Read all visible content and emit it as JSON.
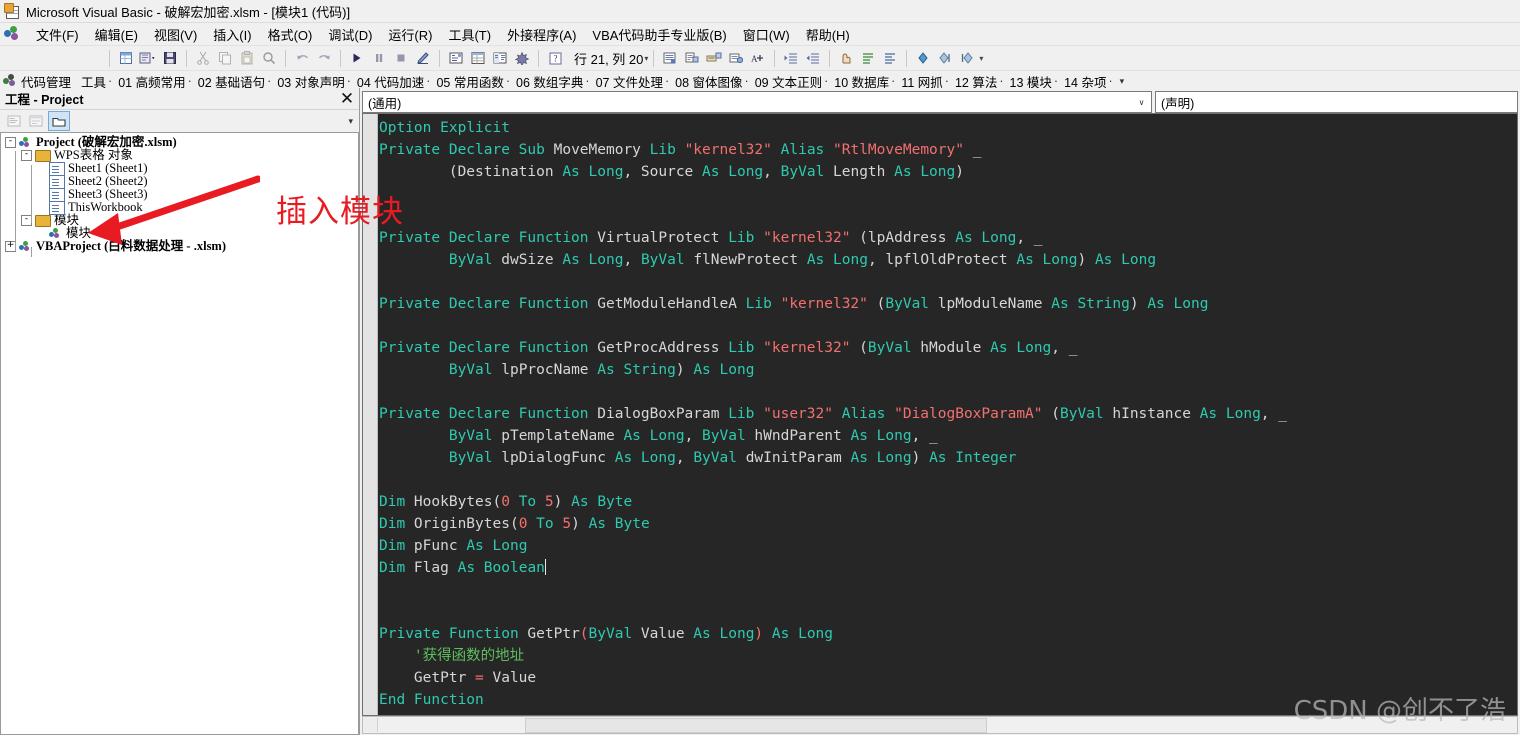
{
  "window": {
    "title": "Microsoft Visual Basic - 破解宏加密.xlsm - [模块1 (代码)]",
    "app_icon": "excel-vba-icon"
  },
  "menubar": {
    "logo_icon": "visual-basic-logo-icon",
    "items": [
      {
        "label": "文件(F)"
      },
      {
        "label": "编辑(E)"
      },
      {
        "label": "视图(V)"
      },
      {
        "label": "插入(I)"
      },
      {
        "label": "格式(O)"
      },
      {
        "label": "调试(D)"
      },
      {
        "label": "运行(R)"
      },
      {
        "label": "工具(T)"
      },
      {
        "label": "外接程序(A)"
      },
      {
        "label": "VBA代码助手专业版(B)"
      },
      {
        "label": "窗口(W)"
      },
      {
        "label": "帮助(H)"
      }
    ]
  },
  "toolbar": {
    "position_label": "行 21, 列 20",
    "group1": [
      {
        "name": "view-excel-icon",
        "glyph": "▤"
      },
      {
        "name": "insert-object-dropdown-icon",
        "glyph": "▣"
      },
      {
        "name": "save-icon",
        "glyph": "ὋE"
      }
    ],
    "group2": [
      {
        "name": "cut-icon",
        "glyph": "✂"
      },
      {
        "name": "copy-icon",
        "glyph": "❐"
      },
      {
        "name": "paste-icon",
        "glyph": "ὌB"
      },
      {
        "name": "find-icon",
        "glyph": "ὐD"
      }
    ],
    "group3": [
      {
        "name": "undo-icon",
        "glyph": "↶"
      },
      {
        "name": "redo-icon",
        "glyph": "↷"
      }
    ],
    "group4": [
      {
        "name": "run-icon",
        "glyph": "▶"
      },
      {
        "name": "pause-icon",
        "glyph": "⏸"
      },
      {
        "name": "stop-icon",
        "glyph": "■"
      },
      {
        "name": "design-mode-icon",
        "glyph": "◩"
      }
    ],
    "group5": [
      {
        "name": "project-explorer-icon",
        "glyph": "☷"
      },
      {
        "name": "properties-window-icon",
        "glyph": "☰"
      },
      {
        "name": "object-browser-icon",
        "glyph": "⧉"
      },
      {
        "name": "toolbox-icon",
        "glyph": "⚒"
      }
    ],
    "group6": [
      {
        "name": "help-icon",
        "glyph": "?"
      }
    ],
    "group7": [
      {
        "name": "list-properties-icon",
        "glyph": "▥"
      },
      {
        "name": "list-constants-icon",
        "glyph": "▦"
      },
      {
        "name": "quick-info-icon",
        "glyph": "▧"
      },
      {
        "name": "parameter-info-icon",
        "glyph": "▨"
      },
      {
        "name": "complete-word-icon",
        "glyph": "A+"
      }
    ],
    "group8": [
      {
        "name": "indent-icon",
        "glyph": "⇥"
      },
      {
        "name": "outdent-icon",
        "glyph": "⇤"
      }
    ],
    "group9": [
      {
        "name": "toggle-breakpoint-icon",
        "glyph": "✋"
      },
      {
        "name": "comment-block-icon",
        "glyph": "≡"
      },
      {
        "name": "uncomment-block-icon",
        "glyph": "≢"
      }
    ],
    "group10": [
      {
        "name": "toggle-bookmark-icon",
        "glyph": "◆"
      },
      {
        "name": "next-bookmark-icon",
        "glyph": "⫼"
      },
      {
        "name": "previous-bookmark-icon",
        "glyph": "⫽"
      }
    ]
  },
  "code_manager_bar": {
    "logo_icon": "code-manager-logo-icon",
    "title": "代码管理",
    "items": [
      "工具",
      "01 高频常用",
      "02 基础语句",
      "03 对象声明",
      "04 代码加速",
      "05 常用函数",
      "06 数组字典",
      "07 文件处理",
      "08 窗体图像",
      "09 文本正则",
      "10 数据库",
      "11 网抓",
      "12 算法",
      "13 模块",
      "14 杂项"
    ]
  },
  "project_explorer": {
    "title": "工程 - Project",
    "close_label": "✕",
    "toolbar": [
      {
        "name": "view-code-button",
        "glyph": "▤",
        "selected": false
      },
      {
        "name": "view-object-button",
        "glyph": "▧",
        "selected": false
      },
      {
        "name": "toggle-folders-button",
        "glyph": "Ὄ1",
        "selected": true
      }
    ],
    "tree": [
      {
        "indent": 0,
        "expander": "-",
        "icon": "vb-project-icon",
        "label": "Project  (破解宏加密.xlsm)",
        "bold": true
      },
      {
        "indent": 1,
        "expander": "-",
        "icon": "folder-icon",
        "label": "WPS表格  对象",
        "bold": false
      },
      {
        "indent": 2,
        "expander": "",
        "icon": "sheet-icon",
        "label": "Sheet1  (Sheet1)",
        "bold": false
      },
      {
        "indent": 2,
        "expander": "",
        "icon": "sheet-icon",
        "label": "Sheet2  (Sheet2)",
        "bold": false
      },
      {
        "indent": 2,
        "expander": "",
        "icon": "sheet-icon",
        "label": "Sheet3  (Sheet3)",
        "bold": false
      },
      {
        "indent": 2,
        "expander": "",
        "icon": "sheet-icon",
        "label": "ThisWorkbook",
        "bold": false
      },
      {
        "indent": 1,
        "expander": "-",
        "icon": "folder-icon",
        "label": "模块",
        "bold": false
      },
      {
        "indent": 2,
        "expander": "",
        "icon": "module-icon",
        "label": "模块",
        "bold": false
      },
      {
        "indent": 0,
        "expander": "+",
        "icon": "vb-project-icon",
        "label": "VBAProject  (白料数据处理 - .xlsm)",
        "bold": true
      }
    ]
  },
  "code_window": {
    "object_combo": {
      "value": "(通用)",
      "arrow": "∨"
    },
    "procedure_combo": {
      "value": "(声明)",
      "arrow": "∨"
    },
    "lines": [
      [
        {
          "t": "Option",
          "c": "kw"
        },
        {
          "t": " ",
          "c": "id"
        },
        {
          "t": "Explicit",
          "c": "kw"
        }
      ],
      [
        {
          "t": "Private Declare Sub",
          "c": "kw"
        },
        {
          "t": " MoveMemory ",
          "c": "id"
        },
        {
          "t": "Lib",
          "c": "kw"
        },
        {
          "t": " ",
          "c": "id"
        },
        {
          "t": "\"kernel32\"",
          "c": "str"
        },
        {
          "t": " ",
          "c": "id"
        },
        {
          "t": "Alias",
          "c": "kw"
        },
        {
          "t": " ",
          "c": "id"
        },
        {
          "t": "\"RtlMoveMemory\"",
          "c": "str"
        },
        {
          "t": " _",
          "c": "cont"
        }
      ],
      [
        {
          "t": "        (Destination ",
          "c": "id"
        },
        {
          "t": "As",
          "c": "kw"
        },
        {
          "t": " ",
          "c": "id"
        },
        {
          "t": "Long",
          "c": "kw"
        },
        {
          "t": ", Source ",
          "c": "id"
        },
        {
          "t": "As",
          "c": "kw"
        },
        {
          "t": " ",
          "c": "id"
        },
        {
          "t": "Long",
          "c": "kw"
        },
        {
          "t": ", ",
          "c": "id"
        },
        {
          "t": "ByVal",
          "c": "kw"
        },
        {
          "t": " Length ",
          "c": "id"
        },
        {
          "t": "As",
          "c": "kw"
        },
        {
          "t": " ",
          "c": "id"
        },
        {
          "t": "Long",
          "c": "kw"
        },
        {
          "t": ")",
          "c": "id"
        }
      ],
      [],
      [],
      [
        {
          "t": "Private Declare Function",
          "c": "kw"
        },
        {
          "t": " VirtualProtect ",
          "c": "id"
        },
        {
          "t": "Lib",
          "c": "kw"
        },
        {
          "t": " ",
          "c": "id"
        },
        {
          "t": "\"kernel32\"",
          "c": "str"
        },
        {
          "t": " (lpAddress ",
          "c": "id"
        },
        {
          "t": "As",
          "c": "kw"
        },
        {
          "t": " ",
          "c": "id"
        },
        {
          "t": "Long",
          "c": "kw"
        },
        {
          "t": ", _",
          "c": "cont"
        }
      ],
      [
        {
          "t": "        ",
          "c": "id"
        },
        {
          "t": "ByVal",
          "c": "kw"
        },
        {
          "t": " dwSize ",
          "c": "id"
        },
        {
          "t": "As",
          "c": "kw"
        },
        {
          "t": " ",
          "c": "id"
        },
        {
          "t": "Long",
          "c": "kw"
        },
        {
          "t": ", ",
          "c": "id"
        },
        {
          "t": "ByVal",
          "c": "kw"
        },
        {
          "t": " flNewProtect ",
          "c": "id"
        },
        {
          "t": "As",
          "c": "kw"
        },
        {
          "t": " ",
          "c": "id"
        },
        {
          "t": "Long",
          "c": "kw"
        },
        {
          "t": ", lpflOldProtect ",
          "c": "id"
        },
        {
          "t": "As",
          "c": "kw"
        },
        {
          "t": " ",
          "c": "id"
        },
        {
          "t": "Long",
          "c": "kw"
        },
        {
          "t": ") ",
          "c": "id"
        },
        {
          "t": "As",
          "c": "kw"
        },
        {
          "t": " ",
          "c": "id"
        },
        {
          "t": "Long",
          "c": "kw"
        }
      ],
      [],
      [
        {
          "t": "Private Declare Function",
          "c": "kw"
        },
        {
          "t": " GetModuleHandleA ",
          "c": "id"
        },
        {
          "t": "Lib",
          "c": "kw"
        },
        {
          "t": " ",
          "c": "id"
        },
        {
          "t": "\"kernel32\"",
          "c": "str"
        },
        {
          "t": " (",
          "c": "id"
        },
        {
          "t": "ByVal",
          "c": "kw"
        },
        {
          "t": " lpModuleName ",
          "c": "id"
        },
        {
          "t": "As",
          "c": "kw"
        },
        {
          "t": " ",
          "c": "id"
        },
        {
          "t": "String",
          "c": "kw"
        },
        {
          "t": ") ",
          "c": "id"
        },
        {
          "t": "As",
          "c": "kw"
        },
        {
          "t": " ",
          "c": "id"
        },
        {
          "t": "Long",
          "c": "kw"
        }
      ],
      [],
      [
        {
          "t": "Private Declare Function",
          "c": "kw"
        },
        {
          "t": " GetProcAddress ",
          "c": "id"
        },
        {
          "t": "Lib",
          "c": "kw"
        },
        {
          "t": " ",
          "c": "id"
        },
        {
          "t": "\"kernel32\"",
          "c": "str"
        },
        {
          "t": " (",
          "c": "id"
        },
        {
          "t": "ByVal",
          "c": "kw"
        },
        {
          "t": " hModule ",
          "c": "id"
        },
        {
          "t": "As",
          "c": "kw"
        },
        {
          "t": " ",
          "c": "id"
        },
        {
          "t": "Long",
          "c": "kw"
        },
        {
          "t": ", _",
          "c": "cont"
        }
      ],
      [
        {
          "t": "        ",
          "c": "id"
        },
        {
          "t": "ByVal",
          "c": "kw"
        },
        {
          "t": " lpProcName ",
          "c": "id"
        },
        {
          "t": "As",
          "c": "kw"
        },
        {
          "t": " ",
          "c": "id"
        },
        {
          "t": "String",
          "c": "kw"
        },
        {
          "t": ") ",
          "c": "id"
        },
        {
          "t": "As",
          "c": "kw"
        },
        {
          "t": " ",
          "c": "id"
        },
        {
          "t": "Long",
          "c": "kw"
        }
      ],
      [],
      [
        {
          "t": "Private Declare Function",
          "c": "kw"
        },
        {
          "t": " DialogBoxParam ",
          "c": "id"
        },
        {
          "t": "Lib",
          "c": "kw"
        },
        {
          "t": " ",
          "c": "id"
        },
        {
          "t": "\"user32\"",
          "c": "str"
        },
        {
          "t": " ",
          "c": "id"
        },
        {
          "t": "Alias",
          "c": "kw"
        },
        {
          "t": " ",
          "c": "id"
        },
        {
          "t": "\"DialogBoxParamA\"",
          "c": "str"
        },
        {
          "t": " (",
          "c": "id"
        },
        {
          "t": "ByVal",
          "c": "kw"
        },
        {
          "t": " hInstance ",
          "c": "id"
        },
        {
          "t": "As",
          "c": "kw"
        },
        {
          "t": " ",
          "c": "id"
        },
        {
          "t": "Long",
          "c": "kw"
        },
        {
          "t": ", _",
          "c": "cont"
        }
      ],
      [
        {
          "t": "        ",
          "c": "id"
        },
        {
          "t": "ByVal",
          "c": "kw"
        },
        {
          "t": " pTemplateName ",
          "c": "id"
        },
        {
          "t": "As",
          "c": "kw"
        },
        {
          "t": " ",
          "c": "id"
        },
        {
          "t": "Long",
          "c": "kw"
        },
        {
          "t": ", ",
          "c": "id"
        },
        {
          "t": "ByVal",
          "c": "kw"
        },
        {
          "t": " hWndParent ",
          "c": "id"
        },
        {
          "t": "As",
          "c": "kw"
        },
        {
          "t": " ",
          "c": "id"
        },
        {
          "t": "Long",
          "c": "kw"
        },
        {
          "t": ", _",
          "c": "cont"
        }
      ],
      [
        {
          "t": "        ",
          "c": "id"
        },
        {
          "t": "ByVal",
          "c": "kw"
        },
        {
          "t": " lpDialogFunc ",
          "c": "id"
        },
        {
          "t": "As",
          "c": "kw"
        },
        {
          "t": " ",
          "c": "id"
        },
        {
          "t": "Long",
          "c": "kw"
        },
        {
          "t": ", ",
          "c": "id"
        },
        {
          "t": "ByVal",
          "c": "kw"
        },
        {
          "t": " dwInitParam ",
          "c": "id"
        },
        {
          "t": "As",
          "c": "kw"
        },
        {
          "t": " ",
          "c": "id"
        },
        {
          "t": "Long",
          "c": "kw"
        },
        {
          "t": ") ",
          "c": "id"
        },
        {
          "t": "As",
          "c": "kw"
        },
        {
          "t": " ",
          "c": "id"
        },
        {
          "t": "Integer",
          "c": "kw"
        }
      ],
      [],
      [
        {
          "t": "Dim",
          "c": "kw"
        },
        {
          "t": " HookBytes(",
          "c": "id"
        },
        {
          "t": "0",
          "c": "num"
        },
        {
          "t": " ",
          "c": "id"
        },
        {
          "t": "To",
          "c": "kw"
        },
        {
          "t": " ",
          "c": "id"
        },
        {
          "t": "5",
          "c": "num"
        },
        {
          "t": ") ",
          "c": "id"
        },
        {
          "t": "As",
          "c": "kw"
        },
        {
          "t": " ",
          "c": "id"
        },
        {
          "t": "Byte",
          "c": "kw"
        }
      ],
      [
        {
          "t": "Dim",
          "c": "kw"
        },
        {
          "t": " OriginBytes(",
          "c": "id"
        },
        {
          "t": "0",
          "c": "num"
        },
        {
          "t": " ",
          "c": "id"
        },
        {
          "t": "To",
          "c": "kw"
        },
        {
          "t": " ",
          "c": "id"
        },
        {
          "t": "5",
          "c": "num"
        },
        {
          "t": ") ",
          "c": "id"
        },
        {
          "t": "As",
          "c": "kw"
        },
        {
          "t": " ",
          "c": "id"
        },
        {
          "t": "Byte",
          "c": "kw"
        }
      ],
      [
        {
          "t": "Dim",
          "c": "kw"
        },
        {
          "t": " pFunc ",
          "c": "id"
        },
        {
          "t": "As",
          "c": "kw"
        },
        {
          "t": " ",
          "c": "id"
        },
        {
          "t": "Long",
          "c": "kw"
        }
      ],
      [
        {
          "t": "Dim",
          "c": "kw"
        },
        {
          "t": " Flag ",
          "c": "id"
        },
        {
          "t": "As",
          "c": "kw"
        },
        {
          "t": " ",
          "c": "id"
        },
        {
          "t": "Boolean",
          "c": "kw"
        },
        {
          "t": "|",
          "c": "caret"
        }
      ],
      [],
      [],
      [
        {
          "t": "Private Function",
          "c": "kw"
        },
        {
          "t": " GetPtr",
          "c": "id"
        },
        {
          "t": "(",
          "c": "op"
        },
        {
          "t": "ByVal",
          "c": "kw"
        },
        {
          "t": " Value ",
          "c": "id"
        },
        {
          "t": "As",
          "c": "kw"
        },
        {
          "t": " ",
          "c": "id"
        },
        {
          "t": "Long",
          "c": "kw"
        },
        {
          "t": ")",
          "c": "op"
        },
        {
          "t": " ",
          "c": "id"
        },
        {
          "t": "As",
          "c": "kw"
        },
        {
          "t": " ",
          "c": "id"
        },
        {
          "t": "Long",
          "c": "kw"
        }
      ],
      [
        {
          "t": "    '获得函数的地址",
          "c": "cmt"
        }
      ],
      [
        {
          "t": "    GetPtr ",
          "c": "id"
        },
        {
          "t": "=",
          "c": "op"
        },
        {
          "t": " Value",
          "c": "id"
        }
      ],
      [
        {
          "t": "End Function",
          "c": "kw"
        }
      ]
    ]
  },
  "annotations": {
    "insert_module_label": "插入模块",
    "arrow_color": "#e81b23",
    "watermark": "CSDN @创不了浩"
  },
  "colors": {
    "code_background": "#262626",
    "keyword": "#2fc9b0",
    "string": "#f2706f",
    "comment": "#5fbf5f",
    "identifier": "#d6d6d6",
    "chrome": "#f0f0f0",
    "annotation_red": "#e81b23"
  }
}
